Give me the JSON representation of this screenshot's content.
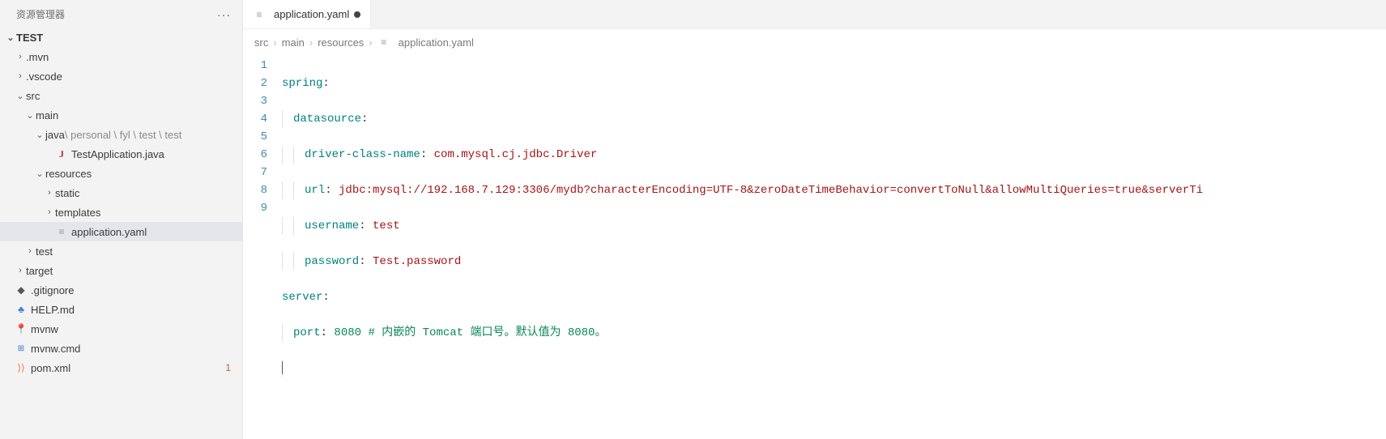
{
  "sidebar": {
    "title": "资源管理器",
    "project": "TEST",
    "items": [
      {
        "label": ".mvn",
        "type": "folder-closed"
      },
      {
        "label": ".vscode",
        "type": "folder-closed"
      },
      {
        "label": "src",
        "type": "folder-open"
      },
      {
        "label": "main",
        "type": "folder-open"
      },
      {
        "label_prefix": "java",
        "label_dim": " \\ personal \\ fyl \\ test \\ test",
        "type": "folder-open-dim"
      },
      {
        "label": "TestApplication.java",
        "type": "java"
      },
      {
        "label": "resources",
        "type": "folder-open"
      },
      {
        "label": "static",
        "type": "folder-closed"
      },
      {
        "label": "templates",
        "type": "folder-closed"
      },
      {
        "label": "application.yaml",
        "type": "yaml",
        "selected": true
      },
      {
        "label": "test",
        "type": "folder-closed"
      },
      {
        "label": "target",
        "type": "folder-closed"
      },
      {
        "label": ".gitignore",
        "type": "git"
      },
      {
        "label": "HELP.md",
        "type": "md"
      },
      {
        "label": "mvnw",
        "type": "pin"
      },
      {
        "label": "mvnw.cmd",
        "type": "win"
      },
      {
        "label": "pom.xml",
        "type": "xml",
        "badge": "1"
      }
    ]
  },
  "tab": {
    "label": "application.yaml",
    "modified": true
  },
  "breadcrumbs": [
    "src",
    "main",
    "resources",
    "application.yaml"
  ],
  "code": {
    "lines": [
      "1",
      "2",
      "3",
      "4",
      "5",
      "6",
      "7",
      "8",
      "9"
    ],
    "l1_key": "spring",
    "l2_key": "datasource",
    "l3_key": "driver-class-name",
    "l3_val": "com.mysql.cj.jdbc.Driver",
    "l4_key": "url",
    "l4_val": "jdbc:mysql://192.168.7.129:3306/mydb?characterEncoding=UTF-8&zeroDateTimeBehavior=convertToNull&allowMultiQueries=true&serverTi",
    "l5_key": "username",
    "l5_val": "test",
    "l6_key": "password",
    "l6_val": "Test.password",
    "l7_key": "server",
    "l8_key": "port",
    "l8_num": "8080",
    "l8_comment": "# 内嵌的 Tomcat 端口号。默认值为 8080。"
  }
}
